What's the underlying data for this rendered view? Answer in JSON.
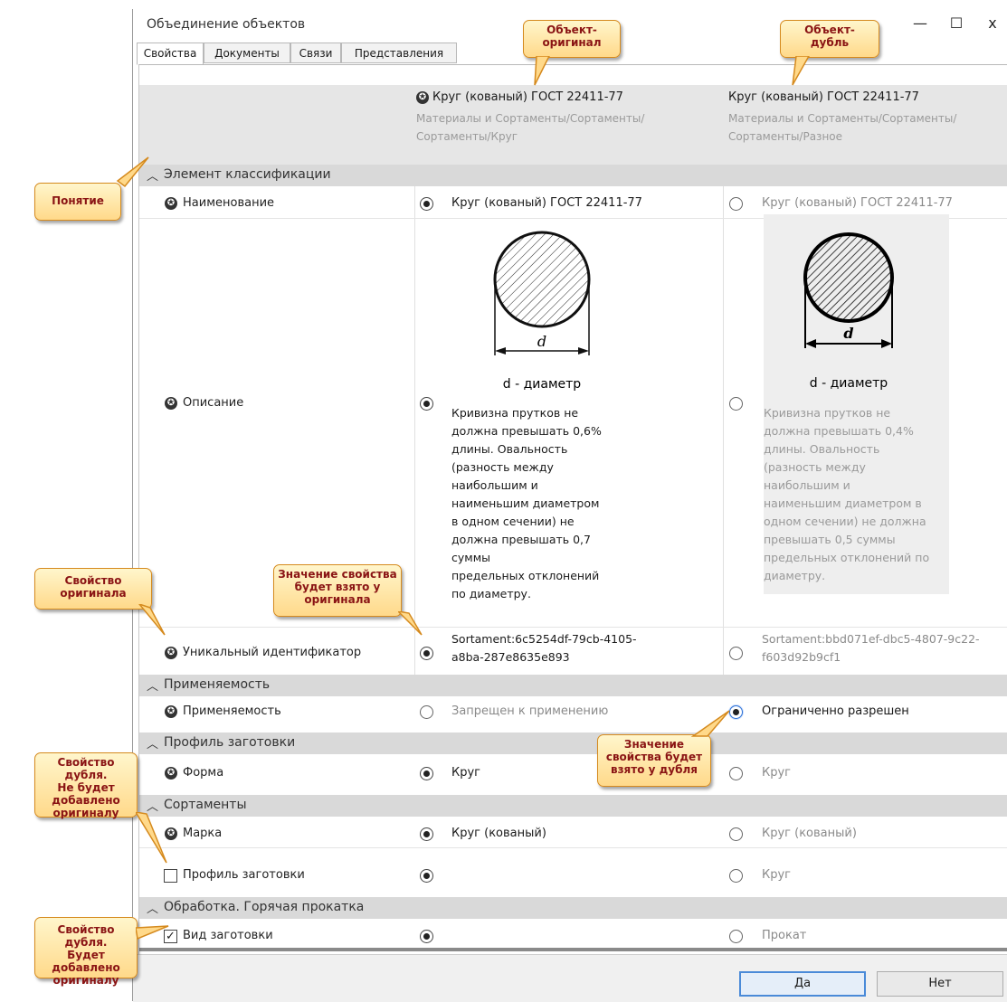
{
  "window": {
    "title": "Объединение объектов",
    "controls": {
      "minimize": "—",
      "maximize": "☐",
      "close": "x"
    }
  },
  "tabs": [
    {
      "label": "Свойства",
      "active": true
    },
    {
      "label": "Документы",
      "active": false
    },
    {
      "label": "Связи",
      "active": false
    },
    {
      "label": "Представления",
      "active": false
    }
  ],
  "header": {
    "original": {
      "title": "Круг (кованый) ГОСТ 22411-77",
      "path_line1": "Материалы и Сортаменты/Сортаменты/",
      "path_line2": "Сортаменты/Круг"
    },
    "duplicate": {
      "title": "Круг (кованый) ГОСТ 22411-77",
      "path_line1": "Материалы и Сортаменты/Сортаменты/",
      "path_line2": "Сортаменты/Разное"
    }
  },
  "sections": {
    "classification": "Элемент классификации",
    "applicability": "Применяемость",
    "billet_profile": "Профиль заготовки",
    "assortments": "Сортаменты",
    "hot_rolling": "Обработка. Горячая прокатка"
  },
  "rows": {
    "name": {
      "label": "Наименование",
      "original": "Круг (кованый) ГОСТ 22411-77",
      "duplicate": "Круг (кованый) ГОСТ 22411-77"
    },
    "description": {
      "label": "Описание",
      "image_caption": "d - диаметр",
      "image_letter": "d",
      "original_lines": [
        "Кривизна прутков не",
        "должна превышать 0,6%",
        "длины. Овальность",
        "(разность между",
        "наибольшим и",
        "наименьшим диаметром",
        "в одном сечении) не",
        "должна превышать 0,7",
        "суммы",
        "предельных отклонений",
        "по диаметру."
      ],
      "duplicate_lines": [
        "Кривизна прутков не",
        "должна превышать 0,4%",
        "длины. Овальность",
        "(разность между",
        "наибольшим и",
        "наименьшим диаметром в",
        "одном сечении) не должна",
        "превышать 0,5 суммы",
        "предельных отклонений по",
        "диаметру."
      ]
    },
    "uid": {
      "label": "Уникальный идентификатор",
      "original_line1": "Sortament:6c5254df-79cb-4105-",
      "original_line2": "a8ba-287e8635e893",
      "duplicate_line1": "Sortament:bbd071ef-dbc5-4807-9c22-",
      "duplicate_line2": "f603d92b9cf1"
    },
    "applicability": {
      "label": "Применяемость",
      "original": "Запрещен к применению",
      "duplicate": "Ограниченно разрешен"
    },
    "shape": {
      "label": "Форма",
      "original": "Круг",
      "duplicate": "Круг"
    },
    "grade": {
      "label": "Марка",
      "original": "Круг (кованый)",
      "duplicate": "Круг (кованый)"
    },
    "profile": {
      "label": "Профиль заготовки",
      "original": "",
      "duplicate": "Круг",
      "checked": false
    },
    "billet_type": {
      "label": "Вид заготовки",
      "original": "",
      "duplicate": "Прокат",
      "checked": true,
      "check_glyph": "✓"
    }
  },
  "footer": {
    "yes": "Да",
    "no": "Нет"
  },
  "callouts": {
    "original": [
      "Объект-",
      "оригинал"
    ],
    "duplicate": [
      "Объект-",
      "дубль"
    ],
    "concept": [
      "Понятие"
    ],
    "prop_original": [
      "Свойство",
      "оригинала"
    ],
    "value_from_original": [
      "Значение свойства",
      "будет взято у",
      "оригинала"
    ],
    "value_from_duplicate": [
      "Значение",
      "свойства будет",
      "взято у дубля"
    ],
    "dup_not_added": [
      "Свойство дубля.",
      "Не будет",
      "добавлено",
      "оригиналу"
    ],
    "dup_added": [
      "Свойство дубля.",
      "Будет добавлено",
      "оригиналу"
    ]
  },
  "colors": {
    "header_bg": "#e6e6e6",
    "section_bg": "#d9d9d9",
    "callout_text": "#8a1414",
    "callout_border": "#d58a1e",
    "primary_button_border": "#4a8ad8"
  },
  "icons": {
    "property": "star-in-circle-icon",
    "expand": "chevron-up-icon"
  }
}
